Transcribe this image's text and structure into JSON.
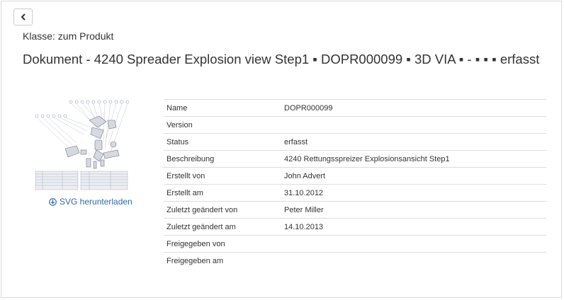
{
  "header": {
    "back_icon": "chevron-left-icon",
    "class_line": "Klasse: zum Produkt",
    "title": "Dokument - 4240 Spreader Explosion view Step1 ▪ DOPR000099 ▪ 3D VIA ▪ - ▪ ▪ ▪ erfasst"
  },
  "preview": {
    "download_icon": "download-circle-icon",
    "download_label": "SVG herunterladen"
  },
  "properties": [
    {
      "key": "Name",
      "value": "DOPR000099"
    },
    {
      "key": "Version",
      "value": ""
    },
    {
      "key": "Status",
      "value": "erfasst"
    },
    {
      "key": "Beschreibung",
      "value": "4240 Rettungsspreizer Explosionsansicht Step1"
    },
    {
      "key": "Erstellt von",
      "value": "John Advert"
    },
    {
      "key": "Erstellt am",
      "value": "31.10.2012"
    },
    {
      "key": "Zuletzt geändert von",
      "value": "Peter Miller"
    },
    {
      "key": "Zuletzt geändert am",
      "value": "14.10.2013"
    },
    {
      "key": "Freigegeben von",
      "value": ""
    },
    {
      "key": "Freigegeben am",
      "value": ""
    }
  ],
  "colors": {
    "link": "#2f6aa6",
    "border": "#dddddd",
    "text": "#333333"
  }
}
